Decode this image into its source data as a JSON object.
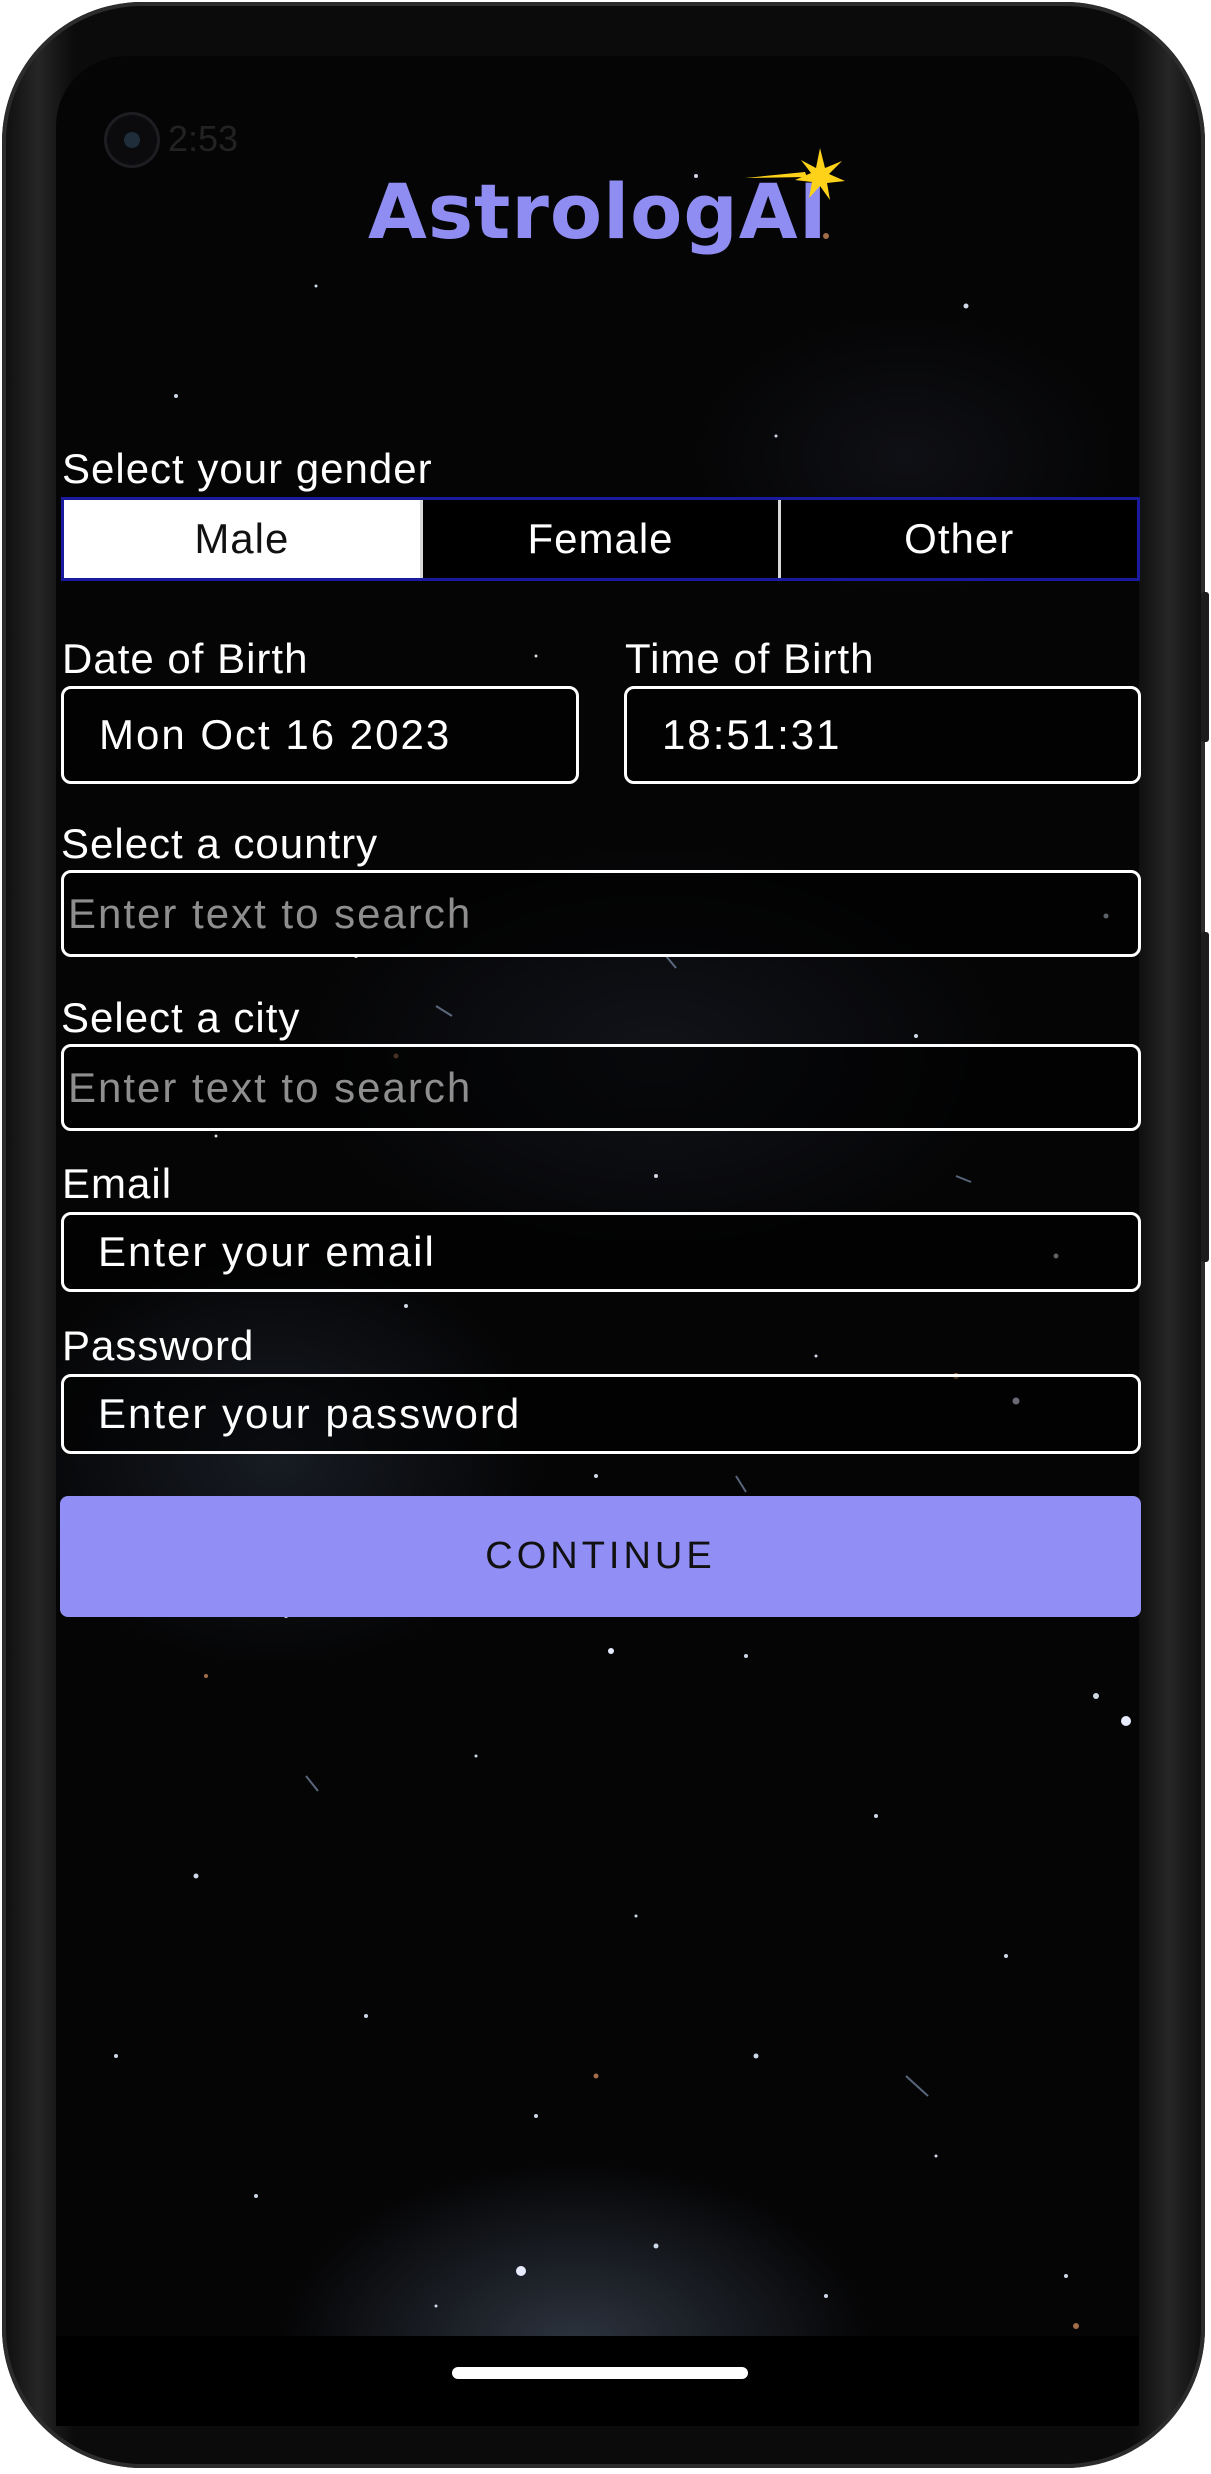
{
  "status_bar": {
    "time": "2:53"
  },
  "app": {
    "logo_text": "AstrologAI",
    "accent_color": "#918ef5"
  },
  "gender": {
    "label": "Select your gender",
    "options": [
      "Male",
      "Female",
      "Other"
    ],
    "selected": "Male"
  },
  "birth": {
    "date_label": "Date of Birth",
    "date_value": "Mon Oct 16 2023",
    "time_label": "Time of Birth",
    "time_value": "18:51:31"
  },
  "country": {
    "label": "Select a country",
    "placeholder": "Enter text to search"
  },
  "city": {
    "label": "Select a city",
    "placeholder": "Enter text to search"
  },
  "email": {
    "label": "Email",
    "placeholder": "Enter your email"
  },
  "password": {
    "label": "Password",
    "placeholder": "Enter your password"
  },
  "continue_label": "CONTINUE"
}
